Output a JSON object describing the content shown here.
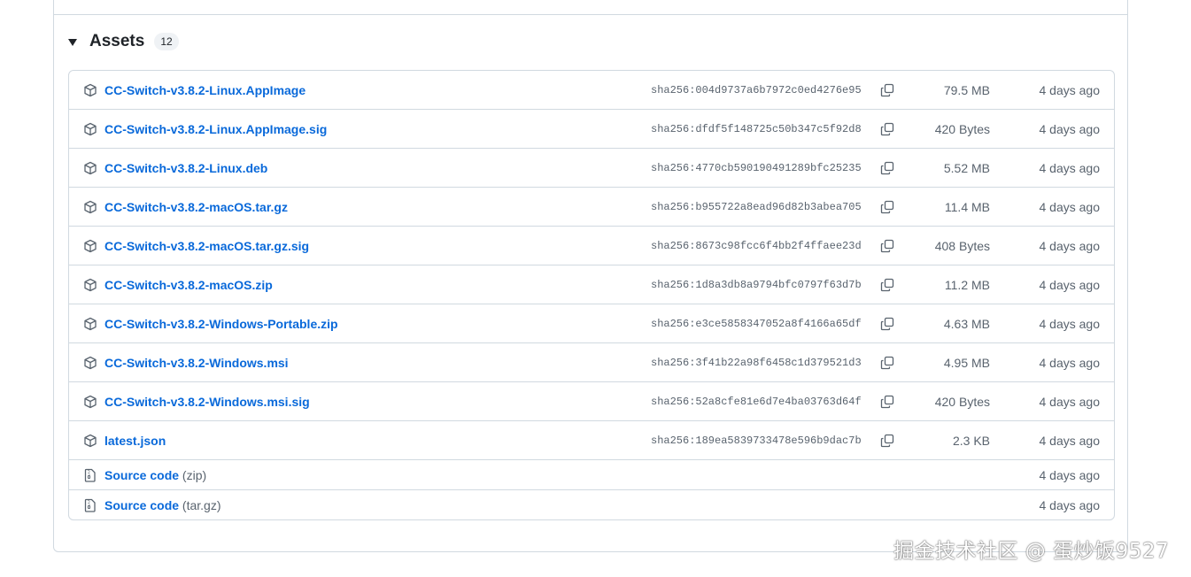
{
  "assets": {
    "title": "Assets",
    "count": "12",
    "files": [
      {
        "name": "CC-Switch-v3.8.2-Linux.AppImage",
        "sha": "sha256:004d9737a6b7972c0ed4276e95",
        "size": "79.5 MB",
        "date": "4 days ago"
      },
      {
        "name": "CC-Switch-v3.8.2-Linux.AppImage.sig",
        "sha": "sha256:dfdf5f148725c50b347c5f92d8",
        "size": "420 Bytes",
        "date": "4 days ago"
      },
      {
        "name": "CC-Switch-v3.8.2-Linux.deb",
        "sha": "sha256:4770cb590190491289bfc25235",
        "size": "5.52 MB",
        "date": "4 days ago"
      },
      {
        "name": "CC-Switch-v3.8.2-macOS.tar.gz",
        "sha": "sha256:b955722a8ead96d82b3abea705",
        "size": "11.4 MB",
        "date": "4 days ago"
      },
      {
        "name": "CC-Switch-v3.8.2-macOS.tar.gz.sig",
        "sha": "sha256:8673c98fcc6f4bb2f4ffaee23d",
        "size": "408 Bytes",
        "date": "4 days ago"
      },
      {
        "name": "CC-Switch-v3.8.2-macOS.zip",
        "sha": "sha256:1d8a3db8a9794bfc0797f63d7b",
        "size": "11.2 MB",
        "date": "4 days ago"
      },
      {
        "name": "CC-Switch-v3.8.2-Windows-Portable.zip",
        "sha": "sha256:e3ce5858347052a8f4166a65df",
        "size": "4.63 MB",
        "date": "4 days ago"
      },
      {
        "name": "CC-Switch-v3.8.2-Windows.msi",
        "sha": "sha256:3f41b22a98f6458c1d379521d3",
        "size": "4.95 MB",
        "date": "4 days ago"
      },
      {
        "name": "CC-Switch-v3.8.2-Windows.msi.sig",
        "sha": "sha256:52a8cfe81e6d7e4ba03763d64f",
        "size": "420 Bytes",
        "date": "4 days ago"
      },
      {
        "name": "latest.json",
        "sha": "sha256:189ea5839733478e596b9dac7b",
        "size": "2.3 KB",
        "date": "4 days ago"
      }
    ],
    "source": [
      {
        "label": "Source code",
        "ext": "(zip)",
        "date": "4 days ago"
      },
      {
        "label": "Source code",
        "ext": "(tar.gz)",
        "date": "4 days ago"
      }
    ]
  },
  "watermark": "掘金技术社区 @ 蛋炒饭9527",
  "colors": {
    "link": "#0969da",
    "muted": "#59636e",
    "border": "#d1d9e0",
    "badge": "#eff2f5"
  },
  "icons": {
    "asset": "package-icon",
    "copy": "copy-icon",
    "source": "file-zip-icon",
    "toggle": "triangle-down-icon"
  }
}
